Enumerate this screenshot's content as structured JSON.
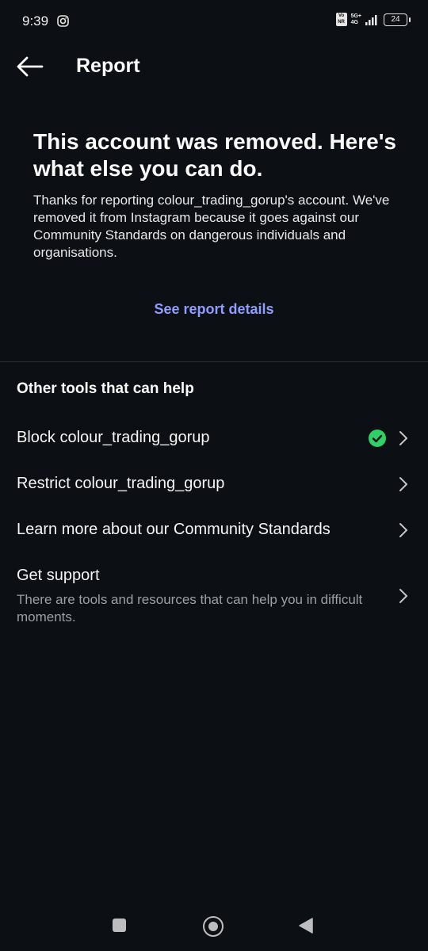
{
  "status_bar": {
    "time": "9:39",
    "volte": "Vo NR",
    "network_top": "5G+",
    "network_bottom": "4G",
    "battery": "24"
  },
  "header": {
    "title": "Report",
    "back_icon": "arrow-left-icon"
  },
  "hero": {
    "title": "This account was removed. Here's what else you can do.",
    "body": "Thanks for reporting colour_trading_gorup's account. We've removed it from Instagram because it goes against our Community Standards on dangerous individuals and organisations."
  },
  "report_link": "See report details",
  "tools": {
    "title": "Other tools that can help",
    "items": [
      {
        "label": "Block colour_trading_gorup",
        "status": "done"
      },
      {
        "label": "Restrict colour_trading_gorup"
      },
      {
        "label": "Learn more about our Community Standards"
      },
      {
        "label": "Get support",
        "sublabel": "There are tools and resources that can help you in difficult moments."
      }
    ]
  },
  "colors": {
    "background": "#0c1014",
    "link": "#8e9dff",
    "check": "#2fd167"
  }
}
